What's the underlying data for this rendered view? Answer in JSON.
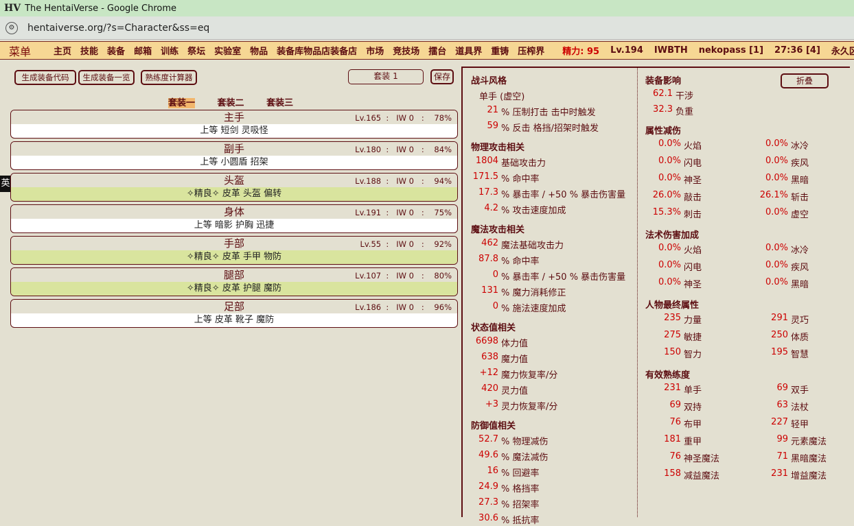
{
  "browser": {
    "title": "The HentaiVerse - Google Chrome",
    "logo": "HV",
    "url": "hentaiverse.org/?s=Character&ss=eq"
  },
  "menu": {
    "root": "菜单",
    "items": [
      "主页",
      "技能",
      "装备",
      "邮箱",
      "训练",
      "祭坛",
      "实验室",
      "物品",
      "装备库",
      "物品店",
      "装备店",
      "市场",
      "竞技场",
      "擂台",
      "道具界",
      "重铸",
      "压榨界"
    ],
    "stamina": "精力: 95",
    "level": "Lv.194",
    "mode": "IWBTH",
    "user": "nekopass [1]",
    "time": "27:36 [4]",
    "realm": "永久区"
  },
  "actions": {
    "gen_code": "生成装备代码",
    "gen_list": "生成装备一览",
    "calc": "熟练度计算器",
    "set_input": "套装 1",
    "save": "保存",
    "fold": "折叠"
  },
  "settabs": [
    "套装一",
    "套装二",
    "套装三"
  ],
  "ime": "英",
  "slots": [
    {
      "name": "主手",
      "info": "Lv.165  :   IW 0   :    78%",
      "item": "上等 短剑 灵吸怪",
      "magic": false
    },
    {
      "name": "副手",
      "info": "Lv.180  :   IW 0   :    84%",
      "item": "上等 小圆盾 招架",
      "magic": false
    },
    {
      "name": "头盔",
      "info": "Lv.188  :   IW 0   :    94%",
      "item": "✧精良✧ 皮革 头盔 偏转",
      "magic": true
    },
    {
      "name": "身体",
      "info": "Lv.191  :   IW 0   :    75%",
      "item": "上等 暗影 护胸 迅捷",
      "magic": false
    },
    {
      "name": "手部",
      "info": "Lv.55  :   IW 0   :    92%",
      "item": "✧精良✧ 皮革 手甲 物防",
      "magic": true
    },
    {
      "name": "腿部",
      "info": "Lv.107  :   IW 0   :    80%",
      "item": "✧精良✧ 皮革 护腿 魔防",
      "magic": true
    },
    {
      "name": "足部",
      "info": "Lv.186  :   IW 0   :    96%",
      "item": "上等 皮革 靴子 魔防",
      "magic": false
    }
  ],
  "left_col": {
    "fight_style": {
      "header": "战斗风格",
      "type": "单手 (虚空)",
      "rows": [
        {
          "v": "21",
          "t": "% 压制打击 击中时触发"
        },
        {
          "v": "59",
          "t": "% 反击 格挡/招架时触发"
        }
      ]
    },
    "phys": {
      "header": "物理攻击相关",
      "rows": [
        {
          "v": "1804",
          "t": "基础攻击力"
        },
        {
          "v": "171.5",
          "t": "% 命中率"
        },
        {
          "v": "17.3",
          "t": "% 暴击率 / +50 % 暴击伤害量"
        },
        {
          "v": "4.2",
          "t": "% 攻击速度加成"
        }
      ]
    },
    "magic": {
      "header": "魔法攻击相关",
      "rows": [
        {
          "v": "462",
          "t": "魔法基础攻击力"
        },
        {
          "v": "87.8",
          "t": "% 命中率"
        },
        {
          "v": "0",
          "t": "% 暴击率 / +50 % 暴击伤害量"
        },
        {
          "v": "131",
          "t": "% 魔力消耗修正"
        },
        {
          "v": "0",
          "t": "% 施法速度加成"
        }
      ]
    },
    "status": {
      "header": "状态值相关",
      "rows": [
        {
          "v": "6698",
          "t": "体力值"
        },
        {
          "v": "638",
          "t": "魔力值"
        },
        {
          "v": "+12",
          "t": "魔力恢复率/分"
        },
        {
          "v": "420",
          "t": "灵力值"
        },
        {
          "v": "+3",
          "t": "灵力恢复率/分"
        }
      ]
    },
    "defense": {
      "header": "防御值相关",
      "rows": [
        {
          "v": "52.7",
          "t": "% 物理减伤"
        },
        {
          "v": "49.6",
          "t": "% 魔法减伤"
        },
        {
          "v": "16",
          "t": "% 回避率"
        },
        {
          "v": "24.9",
          "t": "% 格挡率"
        },
        {
          "v": "27.3",
          "t": "% 招架率"
        },
        {
          "v": "30.6",
          "t": "% 抵抗率"
        }
      ]
    }
  },
  "right_col": {
    "equip_effect": {
      "header": "装备影响",
      "rows": [
        {
          "v": "62.1",
          "t": "干涉"
        },
        {
          "v": "32.3",
          "t": "负重"
        }
      ]
    },
    "elem_mit": {
      "header": "属性减伤",
      "pairs": [
        [
          {
            "v": "0.0%",
            "t": "火焰"
          },
          {
            "v": "0.0%",
            "t": "冰冷"
          }
        ],
        [
          {
            "v": "0.0%",
            "t": "闪电"
          },
          {
            "v": "0.0%",
            "t": "疾风"
          }
        ],
        [
          {
            "v": "0.0%",
            "t": "神圣"
          },
          {
            "v": "0.0%",
            "t": "黑暗"
          }
        ],
        [
          {
            "v": "26.0%",
            "t": "敲击"
          },
          {
            "v": "26.1%",
            "t": "斩击"
          }
        ],
        [
          {
            "v": "15.3%",
            "t": "刺击"
          },
          {
            "v": "0.0%",
            "t": "虚空"
          }
        ]
      ]
    },
    "spell_dmg": {
      "header": "法术伤害加成",
      "pairs": [
        [
          {
            "v": "0.0%",
            "t": "火焰"
          },
          {
            "v": "0.0%",
            "t": "冰冷"
          }
        ],
        [
          {
            "v": "0.0%",
            "t": "闪电"
          },
          {
            "v": "0.0%",
            "t": "疾风"
          }
        ],
        [
          {
            "v": "0.0%",
            "t": "神圣"
          },
          {
            "v": "0.0%",
            "t": "黑暗"
          }
        ]
      ]
    },
    "final_attr": {
      "header": "人物最终属性",
      "pairs": [
        [
          {
            "v": "235",
            "t": "力量"
          },
          {
            "v": "291",
            "t": "灵巧"
          }
        ],
        [
          {
            "v": "275",
            "t": "敏捷"
          },
          {
            "v": "250",
            "t": "体质"
          }
        ],
        [
          {
            "v": "150",
            "t": "智力"
          },
          {
            "v": "195",
            "t": "智慧"
          }
        ]
      ]
    },
    "prof": {
      "header": "有效熟练度",
      "pairs": [
        [
          {
            "v": "231",
            "t": "单手"
          },
          {
            "v": "69",
            "t": "双手"
          }
        ],
        [
          {
            "v": "69",
            "t": "双持"
          },
          {
            "v": "63",
            "t": "法杖"
          }
        ],
        [
          {
            "v": "76",
            "t": "布甲"
          },
          {
            "v": "227",
            "t": "轻甲"
          }
        ],
        [
          {
            "v": "181",
            "t": "重甲"
          },
          {
            "v": "99",
            "t": "元素魔法"
          }
        ],
        [
          {
            "v": "76",
            "t": "神圣魔法"
          },
          {
            "v": "71",
            "t": "黑暗魔法"
          }
        ],
        [
          {
            "v": "158",
            "t": "减益魔法"
          },
          {
            "v": "231",
            "t": "增益魔法"
          }
        ]
      ]
    }
  }
}
